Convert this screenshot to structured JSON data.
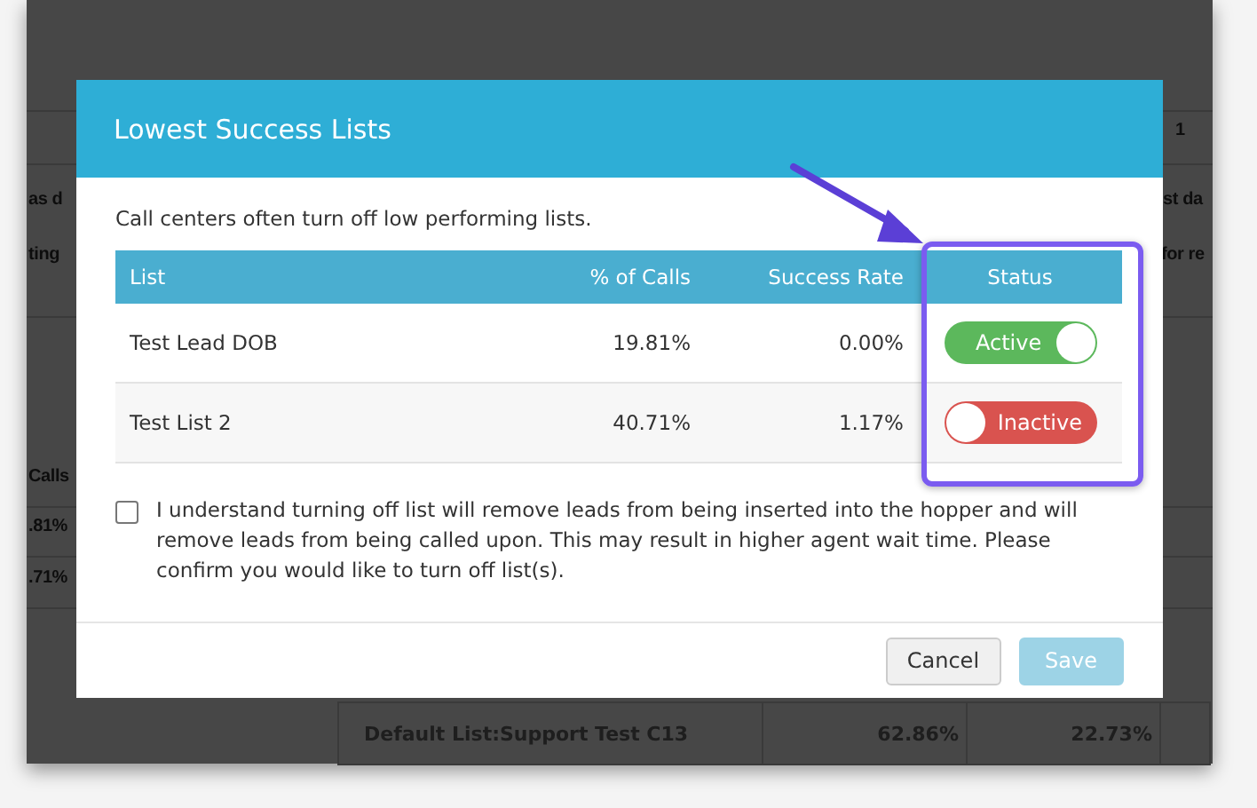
{
  "background": {
    "fragments": [
      "as d",
      "ting",
      "Calls",
      ".81%",
      ".71%",
      "1",
      "st da",
      "for re"
    ],
    "bottom_row": [
      "Default List:Support Test C13",
      "62.86%",
      "22.73%"
    ]
  },
  "modal": {
    "title": "Lowest Success Lists",
    "intro": "Call centers often turn off low performing lists.",
    "columns": [
      "List",
      "% of Calls",
      "Success Rate",
      "Status"
    ],
    "rows": [
      {
        "list": "Test Lead DOB",
        "calls": "19.81%",
        "rate": "0.00%",
        "status": "Active",
        "on": true
      },
      {
        "list": "Test List 2",
        "calls": "40.71%",
        "rate": "1.17%",
        "status": "Inactive",
        "on": false
      }
    ],
    "confirm": {
      "checked": false,
      "text": "I understand turning off list will remove leads from being inserted into the hopper and will remove leads from being called upon. This may result in higher agent wait time. Please confirm you would like to turn off list(s)."
    },
    "buttons": [
      {
        "label": "Cancel",
        "kind": "secondary"
      },
      {
        "label": "Save",
        "kind": "primary",
        "disabled": true
      }
    ]
  }
}
